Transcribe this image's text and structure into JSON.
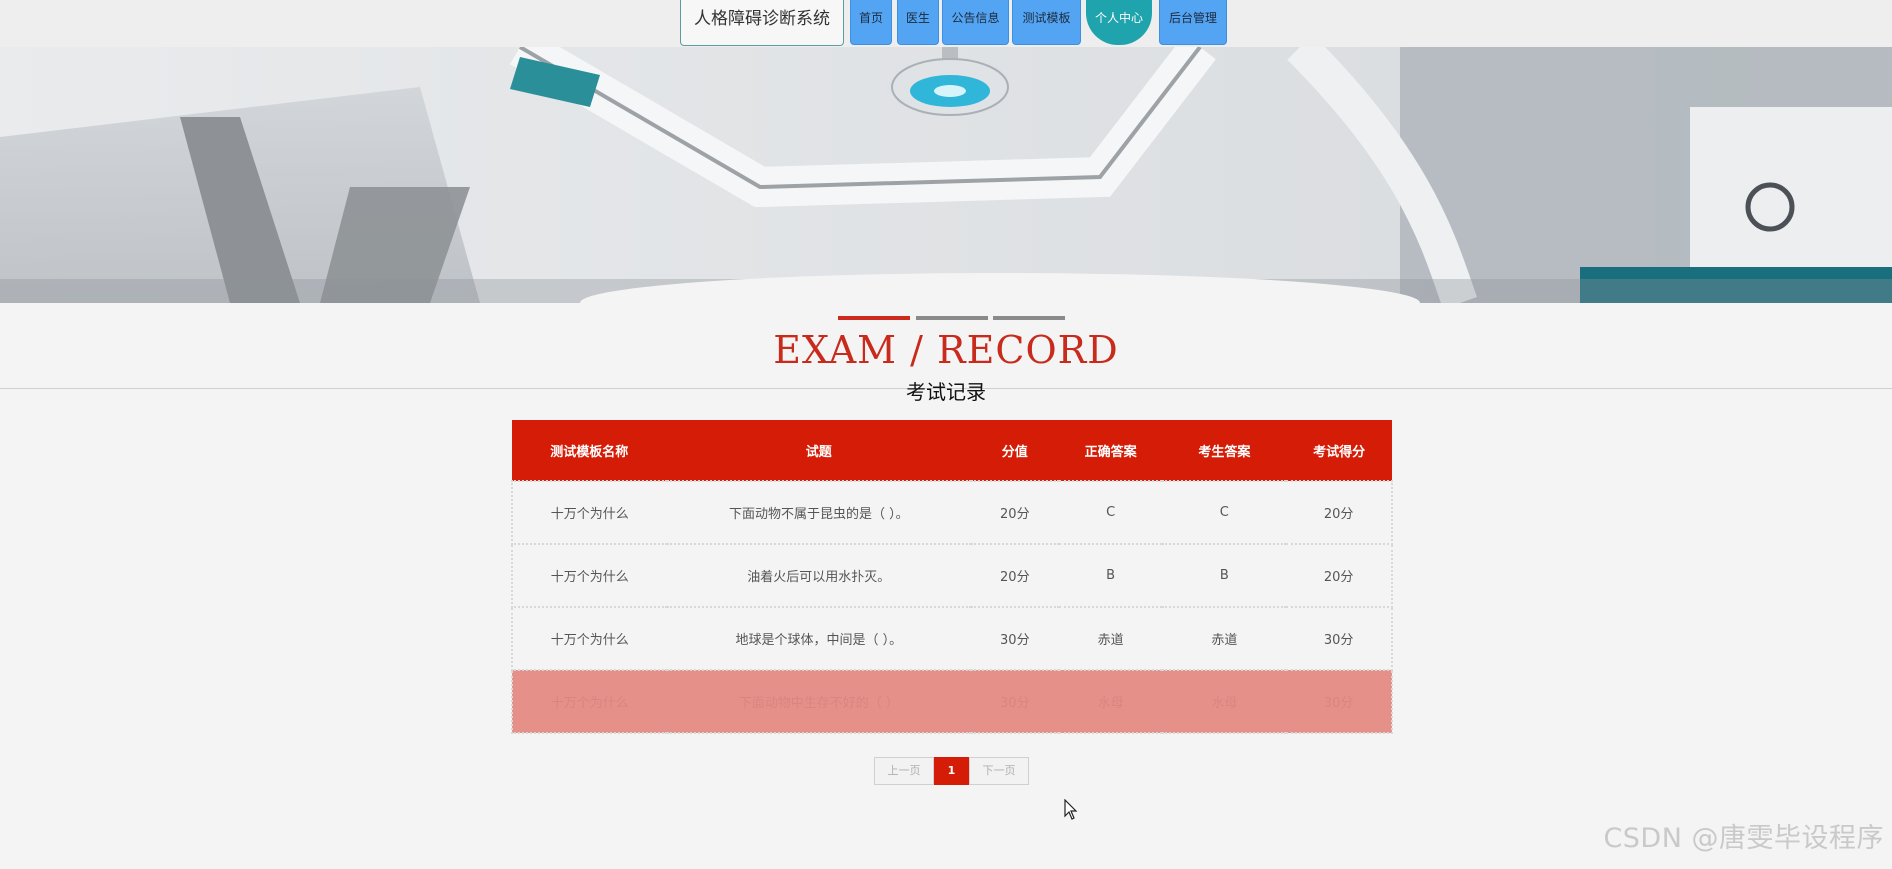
{
  "nav": {
    "brand": "人格障碍诊断系统",
    "items": [
      {
        "label": "首页"
      },
      {
        "label": "医生"
      },
      {
        "label": "公告信息"
      },
      {
        "label": "测试模板"
      },
      {
        "label": "个人中心"
      },
      {
        "label": "后台管理"
      }
    ]
  },
  "section": {
    "title_en": "EXAM / RECORD",
    "title_cn": "考试记录"
  },
  "table": {
    "headers": [
      "测试模板名称",
      "试题",
      "分值",
      "正确答案",
      "考生答案",
      "考试得分"
    ],
    "rows": [
      [
        "十万个为什么",
        "下面动物不属于昆虫的是（ ）。",
        "20分",
        "C",
        "C",
        "20分"
      ],
      [
        "十万个为什么",
        "油着火后可以用水扑灭。",
        "20分",
        "B",
        "B",
        "20分"
      ],
      [
        "十万个为什么",
        "地球是个球体，中间是（ ）。",
        "30分",
        "赤道",
        "赤道",
        "30分"
      ],
      [
        "十万个为什么",
        "下面动物中生存不好的（ ）",
        "30分",
        "水母",
        "水母",
        "30分"
      ]
    ]
  },
  "pager": {
    "prev": "上一页",
    "current": "1",
    "next": "下一页"
  },
  "watermark": "CSDN @唐雯毕设程序",
  "colors": {
    "nav_button": "#54a4f4",
    "nav_active": "#1fa3ac",
    "accent_red": "#d51c06",
    "title_red": "#c82a1c",
    "highlight_row": "#e6908a"
  }
}
